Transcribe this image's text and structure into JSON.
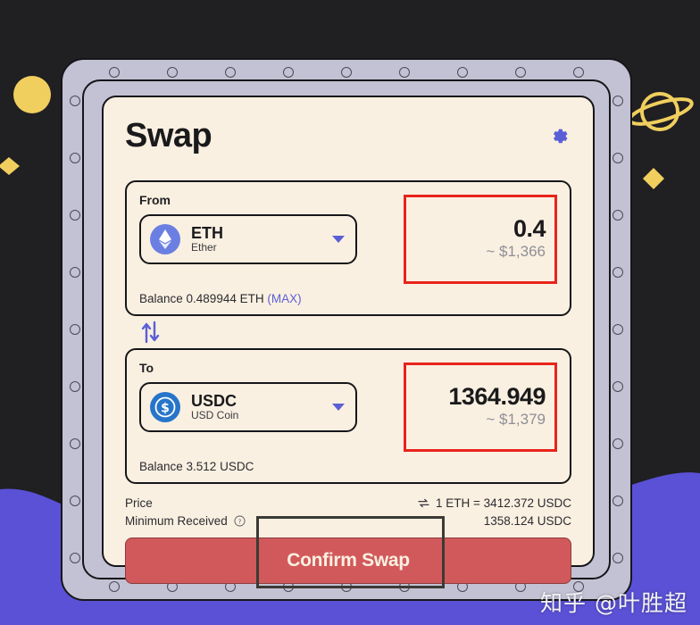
{
  "app": {
    "title": "Swap",
    "settings_icon": "gear-icon"
  },
  "from": {
    "label": "From",
    "token_symbol": "ETH",
    "token_name": "Ether",
    "token_icon": "ethereum-icon",
    "amount": "0.4",
    "amount_usd": "~ $1,366",
    "balance_text": "Balance 0.489944 ETH",
    "max_label": "(MAX)"
  },
  "swap_direction": {
    "icon": "swap-vertical-arrows-icon"
  },
  "to": {
    "label": "To",
    "token_symbol": "USDC",
    "token_name": "USD Coin",
    "token_icon": "usd-coin-icon",
    "amount": "1364.949",
    "amount_usd": "~ $1,379",
    "balance_text": "Balance 3.512 USDC"
  },
  "info": {
    "price_label": "Price",
    "price_value": "1 ETH = 3412.372 USDC",
    "price_swap_icon": "exchange-arrows-icon",
    "minimum_label": "Minimum Received",
    "minimum_help_icon": "question-mark-icon",
    "minimum_value": "1358.124 USDC"
  },
  "action": {
    "confirm_label": "Confirm Swap"
  },
  "watermark": {
    "text": "知乎 @叶胜超"
  },
  "colors": {
    "background": "#201f22",
    "wave": "#5a51d6",
    "frame": "#c3c2d4",
    "card": "#faf0e1",
    "accent": "#5b5fd6",
    "highlight": "#e8241c",
    "confirm": "#d2595b",
    "decoration": "#f0cf5e"
  }
}
